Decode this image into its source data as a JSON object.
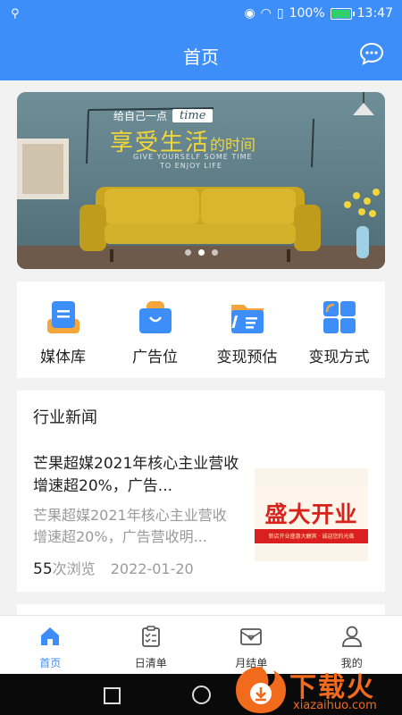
{
  "status_bar": {
    "battery_text": "100%",
    "time": "13:47"
  },
  "header": {
    "title": "首页"
  },
  "banner": {
    "line1": "给自己一点",
    "line1_tag": "time",
    "headline": "享受生活",
    "headline_suffix": "的时间",
    "sub1": "GIVE YOURSELF SOME TIME",
    "sub2": "TO ENJOY LIFE",
    "dots_total": 3,
    "dots_active_index": 1
  },
  "quick_actions": [
    {
      "label": "媒体库",
      "icon": "media-library-icon"
    },
    {
      "label": "广告位",
      "icon": "ad-slot-bag-icon"
    },
    {
      "label": "变现预估",
      "icon": "folder-estimate-icon"
    },
    {
      "label": "变现方式",
      "icon": "grid-tiles-icon"
    }
  ],
  "news": {
    "section_title": "行业新闻",
    "item": {
      "title": "芒果超媒2021年核心主业营收增速超20%，广告...",
      "summary": "芒果超媒2021年核心主业营收增速超20%，广告营收明...",
      "views": "55",
      "views_suffix": "次浏览",
      "date": "2022-01-20",
      "thumb_text": "盛大开业",
      "thumb_subtext": "新店开业盛惠大酬宾 · 诚迎您的光临"
    }
  },
  "tabs": [
    {
      "label": "首页",
      "icon": "home-icon",
      "active": true
    },
    {
      "label": "日清单",
      "icon": "clipboard-icon",
      "active": false
    },
    {
      "label": "月结单",
      "icon": "mail-heart-icon",
      "active": false
    },
    {
      "label": "我的",
      "icon": "user-icon",
      "active": false
    }
  ],
  "watermark": {
    "text": "下载火",
    "url": "xiazaihuo.com"
  },
  "colors": {
    "primary": "#3d8ef8",
    "sofa": "#d4b12a",
    "wall": "#5f7f88"
  }
}
